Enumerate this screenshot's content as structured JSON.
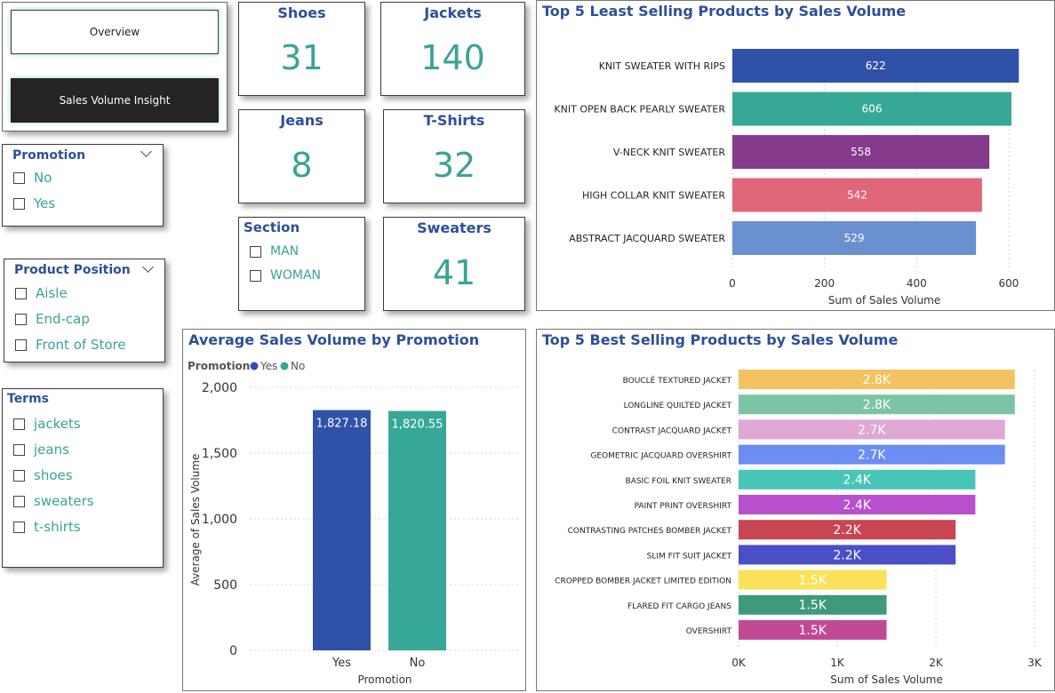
{
  "nav": {
    "overview_label": "Overview",
    "sales_insight_label": "Sales Volume Insight"
  },
  "cards": {
    "shoes": {
      "label": "Shoes",
      "value": "31"
    },
    "jackets": {
      "label": "Jackets",
      "value": "140"
    },
    "jeans": {
      "label": "Jeans",
      "value": "8"
    },
    "tshirts": {
      "label": "T-Shirts",
      "value": "32"
    },
    "sweaters": {
      "label": "Sweaters",
      "value": "41"
    }
  },
  "slicers": {
    "promotion": {
      "title": "Promotion",
      "options": [
        "No",
        "Yes"
      ]
    },
    "section": {
      "title": "Section",
      "options": [
        "MAN",
        "WOMAN"
      ]
    },
    "product_position": {
      "title": "Product Position",
      "options": [
        "Aisle",
        "End-cap",
        "Front of Store"
      ]
    },
    "terms": {
      "title": "Terms",
      "options": [
        "jackets",
        "jeans",
        "shoes",
        "sweaters",
        "t-shirts"
      ]
    }
  },
  "colors": {
    "title_blue": "#2e4f9a",
    "teal": "#3aa394",
    "nav_dark": "#252423"
  },
  "chart_data": [
    {
      "id": "least",
      "type": "bar",
      "orientation": "horizontal",
      "title": "Top 5 Least Selling Products by Sales Volume",
      "xlabel": "Sum of Sales Volume",
      "ylabel": "",
      "categories": [
        "KNIT SWEATER WITH RIPS",
        "KNIT OPEN BACK PEARLY SWEATER",
        "V-NECK KNIT SWEATER",
        "HIGH COLLAR KNIT SWEATER",
        "ABSTRACT JACQUARD SWEATER"
      ],
      "values": [
        622,
        606,
        558,
        542,
        529
      ],
      "value_labels": [
        "622",
        "606",
        "558",
        "542",
        "529"
      ],
      "colors": [
        "#2f52a8",
        "#37a897",
        "#863a8c",
        "#e0667a",
        "#6b90cf"
      ],
      "xlim": [
        0,
        660
      ],
      "xticks": [
        0,
        200,
        400,
        600
      ],
      "xtick_labels": [
        "0",
        "200",
        "400",
        "600"
      ],
      "grid": true
    },
    {
      "id": "avg",
      "type": "bar",
      "orientation": "vertical",
      "title": "Average Sales Volume by Promotion",
      "legend_title": "Promotion",
      "legend": [
        {
          "name": "Yes",
          "color": "#2f52a8"
        },
        {
          "name": "No",
          "color": "#37a897"
        }
      ],
      "xlabel": "Promotion",
      "ylabel": "Average of Sales Volume",
      "categories": [
        "Yes",
        "No"
      ],
      "values": [
        1827.18,
        1820.55
      ],
      "value_labels": [
        "1,827.18",
        "1,820.55"
      ],
      "colors": [
        "#2f52a8",
        "#37a897"
      ],
      "ylim": [
        0,
        2000
      ],
      "yticks": [
        0,
        500,
        1000,
        1500,
        2000
      ],
      "ytick_labels": [
        "0",
        "500",
        "1,000",
        "1,500",
        "2,000"
      ],
      "grid": true
    },
    {
      "id": "best",
      "type": "bar",
      "orientation": "horizontal",
      "title": "Top 5 Best Selling Products by Sales Volume",
      "xlabel": "Sum of Sales Volume",
      "ylabel": "",
      "categories": [
        "BOUCLÉ TEXTURED JACKET",
        "LONGLINE QUILTED JACKET",
        "CONTRAST JACQUARD JACKET",
        "GEOMETRIC JACQUARD OVERSHIRT",
        "BASIC FOIL KNIT SWEATER",
        "PAINT PRINT OVERSHIRT",
        "CONTRASTING PATCHES BOMBER JACKET",
        "SLIM FIT SUIT JACKET",
        "CROPPED BOMBER JACKET LIMITED EDITION",
        "FLARED FIT CARGO JEANS",
        "OVERSHIRT"
      ],
      "values": [
        2800,
        2800,
        2700,
        2700,
        2400,
        2400,
        2200,
        2200,
        1500,
        1500,
        1500
      ],
      "value_labels": [
        "2.8K",
        "2.8K",
        "2.7K",
        "2.7K",
        "2.4K",
        "2.4K",
        "2.2K",
        "2.2K",
        "1.5K",
        "1.5K",
        "1.5K"
      ],
      "colors": [
        "#f4c25f",
        "#7ac4a5",
        "#e0a6d4",
        "#6c8df2",
        "#48c5b7",
        "#b84fcc",
        "#c94551",
        "#4a4fc8",
        "#fbe25a",
        "#3e9a7b",
        "#c14a96"
      ],
      "xlim": [
        0,
        3000
      ],
      "xticks": [
        0,
        1000,
        2000,
        3000
      ],
      "xtick_labels": [
        "0K",
        "1K",
        "2K",
        "3K"
      ],
      "grid": true
    }
  ]
}
